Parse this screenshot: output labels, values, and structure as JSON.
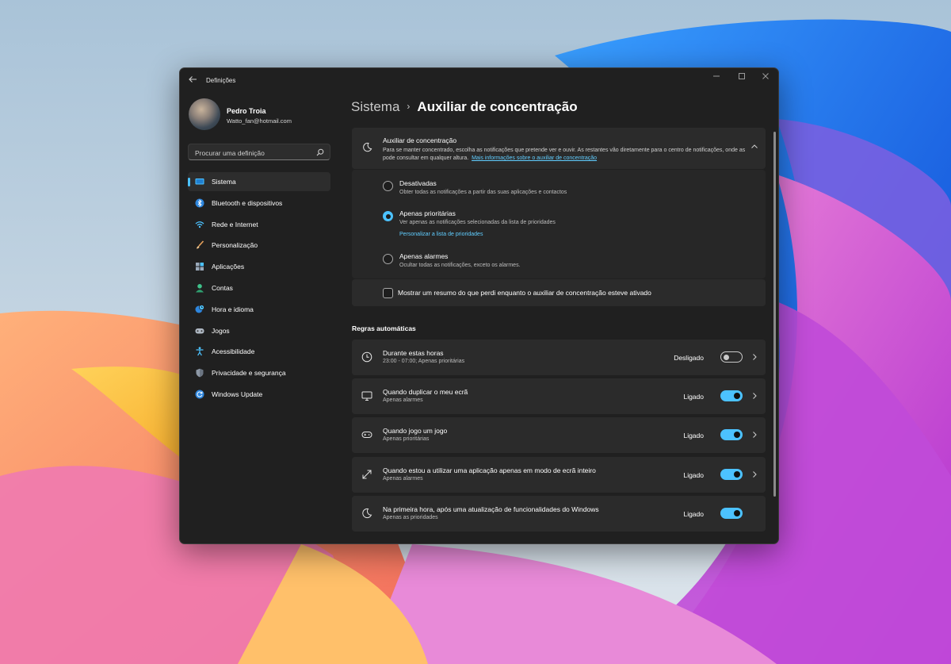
{
  "window": {
    "title": "Definições",
    "controls": [
      "minimize-icon",
      "maximize-icon",
      "close-icon"
    ]
  },
  "profile": {
    "name": "Pedro Troia",
    "email": "Watto_fan@hotmail.com"
  },
  "search": {
    "placeholder": "Procurar uma definição",
    "icon": "search-icon"
  },
  "sidebar": {
    "items": [
      {
        "label": "Sistema",
        "icon": "system-icon",
        "active": true
      },
      {
        "label": "Bluetooth e dispositivos",
        "icon": "bluetooth-icon"
      },
      {
        "label": "Rede e Internet",
        "icon": "wifi-icon"
      },
      {
        "label": "Personalização",
        "icon": "brush-icon"
      },
      {
        "label": "Aplicações",
        "icon": "apps-icon"
      },
      {
        "label": "Contas",
        "icon": "account-icon"
      },
      {
        "label": "Hora e idioma",
        "icon": "globe-clock-icon"
      },
      {
        "label": "Jogos",
        "icon": "gamepad-icon"
      },
      {
        "label": "Acessibilidade",
        "icon": "accessibility-icon"
      },
      {
        "label": "Privacidade e segurança",
        "icon": "shield-icon"
      },
      {
        "label": "Windows Update",
        "icon": "update-icon"
      }
    ]
  },
  "breadcrumb": {
    "root": "Sistema",
    "separator": "›",
    "page": "Auxiliar de concentração"
  },
  "focus_assist": {
    "title": "Auxiliar de concentração",
    "description": "Para se manter concentrado, escolha as notificações que pretende ver e ouvir. As restantes vão diretamente para o centro de notificações, onde as pode consultar em qualquer altura.",
    "link": "Mais informações sobre o auxiliar de concentração",
    "expanded": true,
    "options": [
      {
        "title": "Desativadas",
        "description": "Obter todas as notificações a partir das suas aplicações e contactos",
        "selected": false
      },
      {
        "title": "Apenas prioritárias",
        "description": "Ver apenas as notificações selecionadas da lista de prioridades",
        "link": "Personalizar a lista de prioridades",
        "selected": true
      },
      {
        "title": "Apenas alarmes",
        "description": "Ocultar todas as notificações, exceto os alarmes.",
        "selected": false
      }
    ],
    "summary_checkbox": {
      "label": "Mostrar um resumo do que perdi enquanto o auxiliar de concentração esteve ativado",
      "checked": false
    }
  },
  "automatic_rules": {
    "title": "Regras automáticas",
    "rules": [
      {
        "title": "Durante estas horas",
        "subtitle": "23:00 - 07:00; Apenas prioritárias",
        "status": "Desligado",
        "on": false,
        "icon": "clock-icon",
        "chevron": true
      },
      {
        "title": "Quando duplicar o meu ecrã",
        "subtitle": "Apenas alarmes",
        "status": "Ligado",
        "on": true,
        "icon": "monitor-icon",
        "chevron": true
      },
      {
        "title": "Quando jogo um jogo",
        "subtitle": "Apenas prioritárias",
        "status": "Ligado",
        "on": true,
        "icon": "gamepad-icon",
        "chevron": true
      },
      {
        "title": "Quando estou a utilizar uma aplicação apenas em modo de ecrã inteiro",
        "subtitle": "Apenas alarmes",
        "status": "Ligado",
        "on": true,
        "icon": "fullscreen-icon",
        "chevron": true
      },
      {
        "title": "Na primeira hora, após uma atualização de funcionalidades do Windows",
        "subtitle": "Apenas as prioridades",
        "status": "Ligado",
        "on": true,
        "icon": "moon-icon",
        "chevron": false
      }
    ]
  },
  "colors": {
    "accent": "#4cc2ff",
    "window_bg": "#202020",
    "card_bg": "#2b2b2b",
    "link": "#60cdff"
  }
}
